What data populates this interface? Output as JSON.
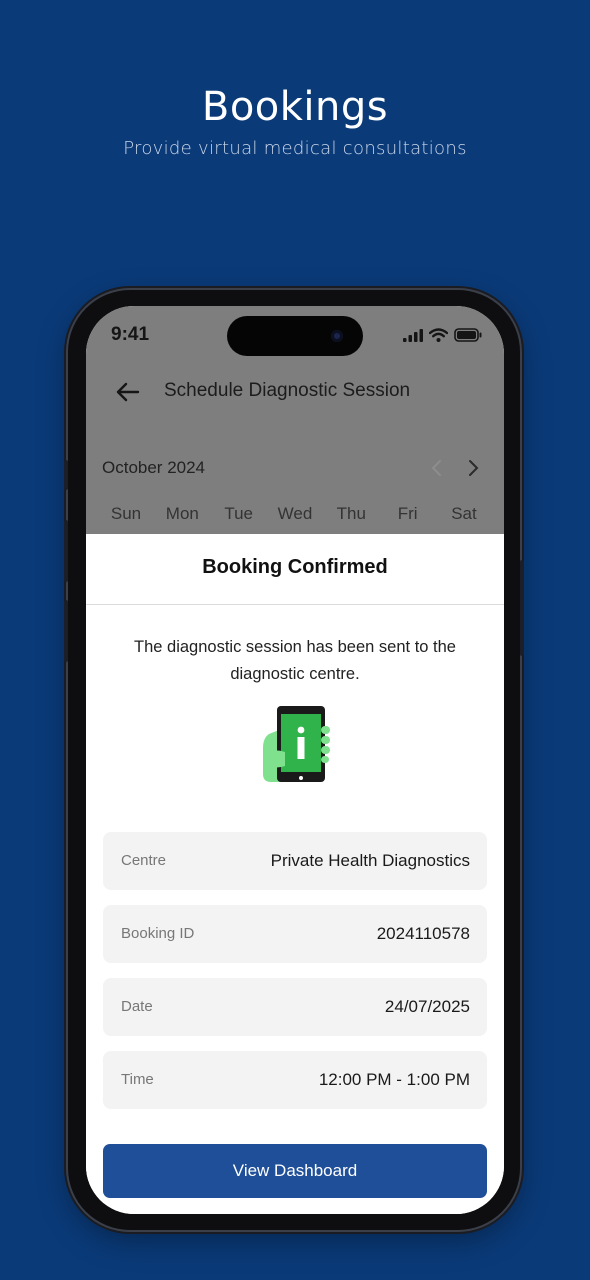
{
  "promo": {
    "title": "Bookings",
    "subtitle": "Provide virtual medical consultations"
  },
  "status_bar": {
    "time": "9:41"
  },
  "header": {
    "title": "Schedule Diagnostic Session",
    "back_icon": "arrow-left-icon"
  },
  "calendar": {
    "month": "October 2024",
    "prev_icon": "chevron-left-icon",
    "next_icon": "chevron-right-icon",
    "weekdays": [
      "Sun",
      "Mon",
      "Tue",
      "Wed",
      "Thu",
      "Fri",
      "Sat"
    ]
  },
  "modal": {
    "title": "Booking Confirmed",
    "message": "The diagnostic session has been sent to the diagnostic centre.",
    "illustration_icon": "phone-info-icon",
    "details": [
      {
        "label": "Centre",
        "value": "Private Health Diagnostics"
      },
      {
        "label": "Booking ID",
        "value": "2024110578"
      },
      {
        "label": "Date",
        "value": "24/07/2025"
      },
      {
        "label": "Time",
        "value": "12:00 PM - 1:00 PM"
      }
    ],
    "button_label": "View Dashboard"
  },
  "colors": {
    "background": "#0a3a78",
    "primary_button": "#1e4f98",
    "accent_green": "#2fb34a",
    "light_green": "#7fe08e"
  }
}
